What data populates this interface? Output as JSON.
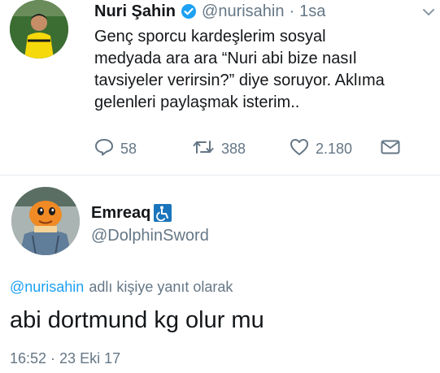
{
  "tweet": {
    "author_name": "Nuri Şahin",
    "handle": "@nurisahin",
    "separator": "·",
    "time": "1sa",
    "text_lines": [
      "Genç sporcu kardeşlerim sosyal",
      "medyada ara ara “Nuri abi bize nasıl",
      "tavsiyeler verirsin?” diye soruyor. Aklıma",
      "gelenleri paylaşmak isterim.."
    ],
    "actions": {
      "replies": "58",
      "retweets": "388",
      "likes": "2.180"
    }
  },
  "reply": {
    "author_name": "Emreaq",
    "handle": "@DolphinSword",
    "context_handle": "@nurisahin",
    "context_text": "adlı kişiye yanıt olarak",
    "text": "abi dortmund kg olur mu",
    "time": "16:52",
    "separator": "·",
    "date": "23 Eki 17"
  },
  "colors": {
    "link": "#1da1f2",
    "muted": "#657786",
    "verified": "#1da1f2",
    "accessibility_badge": "#1b75bc"
  },
  "icons": [
    "verified-badge-icon",
    "chevron-down-icon",
    "reply-icon",
    "retweet-icon",
    "like-icon",
    "message-icon",
    "accessibility-badge-icon"
  ]
}
